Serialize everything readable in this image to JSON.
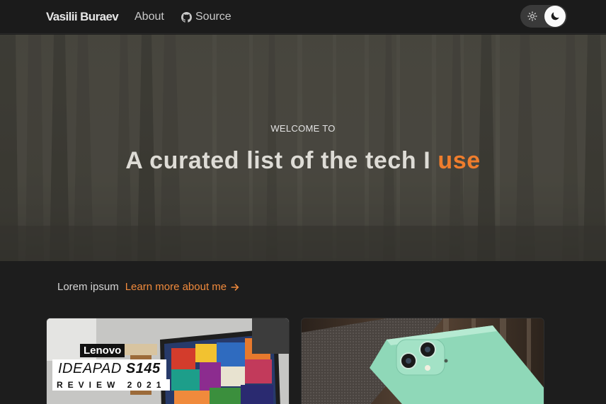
{
  "nav": {
    "brand": "Vasilii Buraev",
    "about": "About",
    "source": "Source",
    "theme_toggle": {
      "light_icon": "sun-icon",
      "dark_icon": "moon-icon",
      "active": "dark"
    }
  },
  "hero": {
    "kicker": "WELCOME TO",
    "title_main": "A curated list of the tech I ",
    "title_accent": "use",
    "accent_color": "#ef7d2d"
  },
  "intro": {
    "text": "Lorem ipsum",
    "link": "Learn more about me",
    "link_icon": "arrow-right-icon"
  },
  "cards": [
    {
      "brand": "Lenovo",
      "model_prefix": "IDEAPAD ",
      "model_suffix": "S145",
      "review_line": "REVIEW 2021"
    },
    {
      "image": "green-smartphone-photo"
    }
  ],
  "colors": {
    "background": "#1d1d1d",
    "navbar": "#1b1b1b",
    "accent": "#ef7d2d",
    "link": "#f08a3c"
  }
}
